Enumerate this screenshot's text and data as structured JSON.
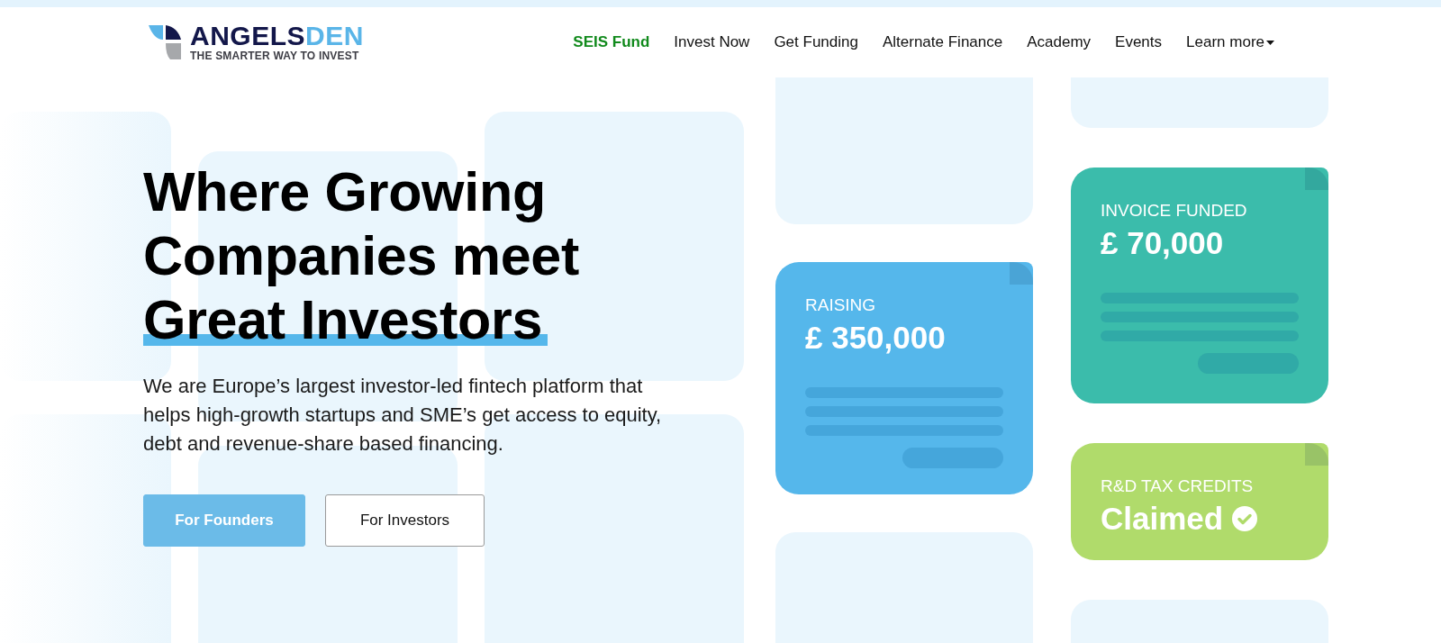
{
  "logo": {
    "name_dark": "ANGELS",
    "name_light": "DEN",
    "tagline": "THE SMARTER WAY TO INVEST"
  },
  "nav": [
    {
      "label": "SEIS Fund",
      "highlighted": true,
      "dropdown": false
    },
    {
      "label": "Invest Now",
      "highlighted": false,
      "dropdown": false
    },
    {
      "label": "Get Funding",
      "highlighted": false,
      "dropdown": false
    },
    {
      "label": "Alternate Finance",
      "highlighted": false,
      "dropdown": false
    },
    {
      "label": "Academy",
      "highlighted": false,
      "dropdown": false
    },
    {
      "label": "Events",
      "highlighted": false,
      "dropdown": false
    },
    {
      "label": "Learn more",
      "highlighted": false,
      "dropdown": true
    }
  ],
  "hero": {
    "heading": "Where Growing Companies meet",
    "heading_highlight": "Great Investors",
    "text": "We are Europe’s largest investor-led fintech platform that helps high-growth startups and SME’s get access to equity, debt and revenue-share based financing.",
    "buttons": [
      {
        "label": "For Founders",
        "kind": "primary"
      },
      {
        "label": "For Investors",
        "kind": "outline"
      }
    ]
  },
  "cards": [
    {
      "kind": "amount",
      "label": "RAISING",
      "value": "£ 350,000",
      "color": "#55b7eb"
    },
    {
      "kind": "amount",
      "label": "INVOICE FUNDED",
      "value": "£ 70,000",
      "color": "#3bbcab"
    },
    {
      "kind": "status",
      "label": "R&D TAX CREDITS",
      "value": "Claimed",
      "color": "#b0db6b"
    }
  ]
}
